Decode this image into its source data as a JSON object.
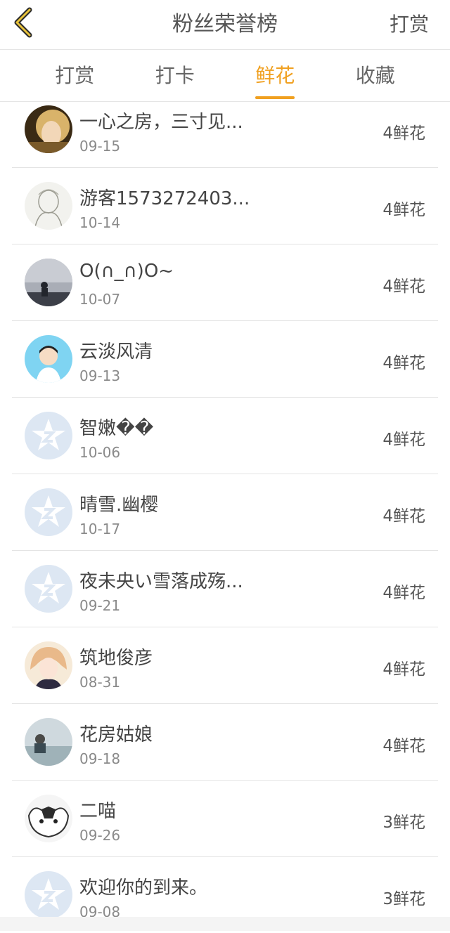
{
  "header": {
    "title": "粉丝荣誉榜",
    "action": "打赏"
  },
  "tabs": [
    {
      "label": "打赏",
      "active": false
    },
    {
      "label": "打卡",
      "active": false
    },
    {
      "label": "鲜花",
      "active": true
    },
    {
      "label": "收藏",
      "active": false
    }
  ],
  "colors": {
    "accent": "#f0a020"
  },
  "list": [
    {
      "name": "一心之房，三寸见...",
      "date": "09-15",
      "count": "4鲜花",
      "avatar": "photo-avatar"
    },
    {
      "name": "游客1573272403...",
      "date": "10-14",
      "count": "4鲜花",
      "avatar": "sketch-avatar"
    },
    {
      "name": "O(∩_∩)O~",
      "date": "10-07",
      "count": "4鲜花",
      "avatar": "photo-avatar"
    },
    {
      "name": "云淡风清",
      "date": "09-13",
      "count": "4鲜花",
      "avatar": "cartoon-avatar"
    },
    {
      "name": "智嫩��",
      "date": "10-06",
      "count": "4鲜花",
      "avatar": "default-star-avatar"
    },
    {
      "name": "晴雪.幽樱",
      "date": "10-17",
      "count": "4鲜花",
      "avatar": "default-star-avatar"
    },
    {
      "name": "夜未央い雪落成殇...",
      "date": "09-21",
      "count": "4鲜花",
      "avatar": "default-star-avatar"
    },
    {
      "name": "筑地俊彦",
      "date": "08-31",
      "count": "4鲜花",
      "avatar": "anime-avatar"
    },
    {
      "name": "花房姑娘",
      "date": "09-18",
      "count": "4鲜花",
      "avatar": "photo-avatar"
    },
    {
      "name": "二喵",
      "date": "09-26",
      "count": "3鲜花",
      "avatar": "cat-avatar"
    },
    {
      "name": "欢迎你的到来。",
      "date": "09-08",
      "count": "3鲜花",
      "avatar": "default-star-avatar"
    }
  ]
}
